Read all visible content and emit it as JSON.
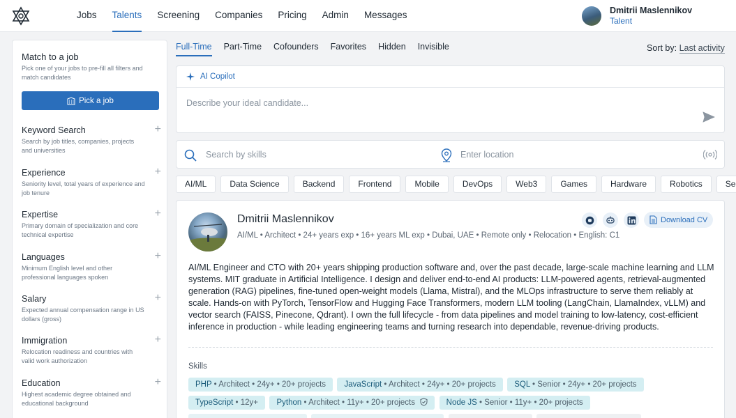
{
  "nav": {
    "items": [
      {
        "label": "Jobs",
        "active": false
      },
      {
        "label": "Talents",
        "active": true
      },
      {
        "label": "Screening",
        "active": false
      },
      {
        "label": "Companies",
        "active": false
      },
      {
        "label": "Pricing",
        "active": false
      },
      {
        "label": "Admin",
        "active": false
      },
      {
        "label": "Messages",
        "active": false
      }
    ]
  },
  "user": {
    "name": "Dmitrii Maslennikov",
    "role": "Talent"
  },
  "filters": {
    "match_title": "Match to a job",
    "match_desc": "Pick one of your jobs to pre-fill all filters and match candidates",
    "pick_button": "Pick a job",
    "items": [
      {
        "title": "Keyword Search",
        "desc": "Search by job titles, companies, projects and universities"
      },
      {
        "title": "Experience",
        "desc": "Seniority level, total years of experience and job tenure"
      },
      {
        "title": "Expertise",
        "desc": "Primary domain of specialization and core technical expertise"
      },
      {
        "title": "Languages",
        "desc": "Minimum English level and other professional languages spoken"
      },
      {
        "title": "Salary",
        "desc": "Expected annual compensation range in US dollars (gross)"
      },
      {
        "title": "Immigration",
        "desc": "Relocation readiness and countries with valid work authorization"
      },
      {
        "title": "Education",
        "desc": "Highest academic degree obtained and educational background"
      }
    ]
  },
  "tabs": [
    "Full-Time",
    "Part-Time",
    "Cofounders",
    "Favorites",
    "Hidden",
    "Invisible"
  ],
  "sort": {
    "label": "Sort by:",
    "value": "Last activity"
  },
  "copilot": {
    "title": "AI Copilot",
    "placeholder": "Describe your ideal candidate..."
  },
  "search": {
    "skills_placeholder": "Search by skills",
    "location_placeholder": "Enter location"
  },
  "categories": [
    "AI/ML",
    "Data Science",
    "Backend",
    "Frontend",
    "Mobile",
    "DevOps",
    "Web3",
    "Games",
    "Hardware",
    "Robotics",
    "Security"
  ],
  "candidate": {
    "name": "Dmitrii Maslennikov",
    "meta": "AI/ML • Architect • 24+ years exp • 16+ years ML exp • Dubai, UAE • Remote only • Relocation • English: C1",
    "download_label": "Download CV",
    "bio": "AI/ML Engineer and CTO with 20+ years shipping production software and, over the past decade, large-scale machine learning and LLM systems. MIT graduate in Artificial Intelligence. I design and deliver end-to-end AI products: LLM-powered agents, retrieval-augmented generation (RAG) pipelines, fine-tuned open-weight models (Llama, Mistral), and the MLOps infrastructure to serve them reliably at scale. Hands-on with PyTorch, TensorFlow and Hugging Face Transformers, modern LLM tooling (LangChain, LlamaIndex, vLLM) and vector search (FAISS, Pinecone, Qdrant). I own the full lifecycle - from data pipelines and model training to low-latency, cost-efficient inference in production - while leading engineering teams and turning research into dependable, revenue-driving products.",
    "skills_label": "Skills",
    "skills": [
      {
        "name": "PHP",
        "detail": " • Architect • 24y+ • 20+ projects"
      },
      {
        "name": "JavaScript",
        "detail": " • Architect • 24y+ • 20+ projects"
      },
      {
        "name": "SQL",
        "detail": " • Senior • 24y+ • 20+ projects"
      },
      {
        "name": "TypeScript",
        "detail": " • 12y+"
      },
      {
        "name": "Python",
        "detail": " • Architect • 11y+ • 20+ projects"
      },
      {
        "name": "Node JS",
        "detail": " • Senior • 11y+ • 20+ projects"
      }
    ]
  },
  "colors": {
    "accent": "#2a6ebb",
    "skill_bg": "#d4eef2"
  }
}
